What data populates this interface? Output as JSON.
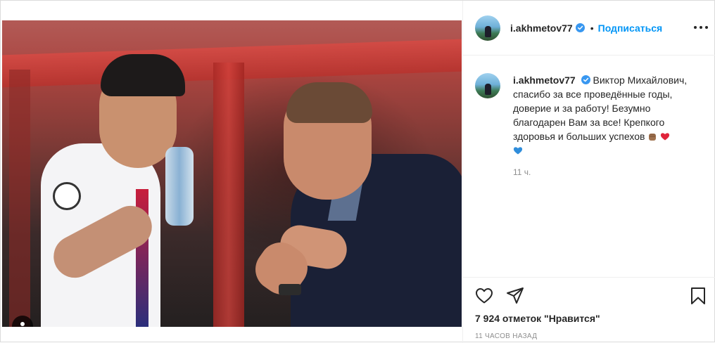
{
  "post": {
    "author": {
      "username": "i.akhmetov77",
      "verified": true,
      "follow_label": "Подписаться",
      "separator": "•"
    },
    "caption": {
      "username": "i.akhmetov77",
      "text": "Виктор Михайлович, спасибо за все проведённые годы, доверие и за работу! Безумно благодарен Вам за все! Крепкого здоровья и больших успехов",
      "emojis": [
        "fist-emoji",
        "red-heart-emoji",
        "blue-heart-emoji"
      ],
      "time": "11 ч."
    },
    "likes_text": "7 924 отметок \"Нравится\"",
    "posted_text": "11 часов назад"
  },
  "icons": {
    "like": "heart-icon",
    "share": "paper-plane-icon",
    "save": "bookmark-icon",
    "more": "more-options-icon",
    "tags": "user-tag-icon",
    "verified": "verified-badge-icon"
  },
  "colors": {
    "link": "#0095f6",
    "verified": "#3897f0",
    "muted": "#8e8e8e",
    "text": "#262626"
  }
}
